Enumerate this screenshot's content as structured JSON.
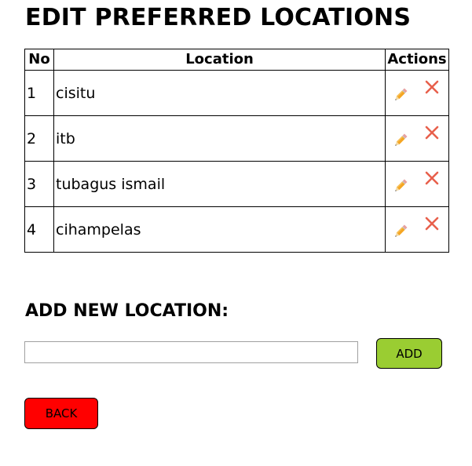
{
  "page": {
    "title": "EDIT PREFERRED LOCATIONS"
  },
  "table": {
    "headers": {
      "no": "No",
      "location": "Location",
      "actions": "Actions"
    },
    "rows": [
      {
        "no": "1",
        "location": "cisitu"
      },
      {
        "no": "2",
        "location": "itb"
      },
      {
        "no": "3",
        "location": "tubagus ismail"
      },
      {
        "no": "4",
        "location": "cihampelas"
      }
    ],
    "icons": {
      "edit": "pencil-icon",
      "delete": "close-icon"
    }
  },
  "add_section": {
    "title": "ADD NEW LOCATION:",
    "input_value": "",
    "input_placeholder": "",
    "add_label": "ADD"
  },
  "back_label": "BACK",
  "colors": {
    "add_button": "#9acd32",
    "back_button": "#ff0000",
    "edit_icon": "#f5a623",
    "delete_icon": "#e8604c"
  }
}
